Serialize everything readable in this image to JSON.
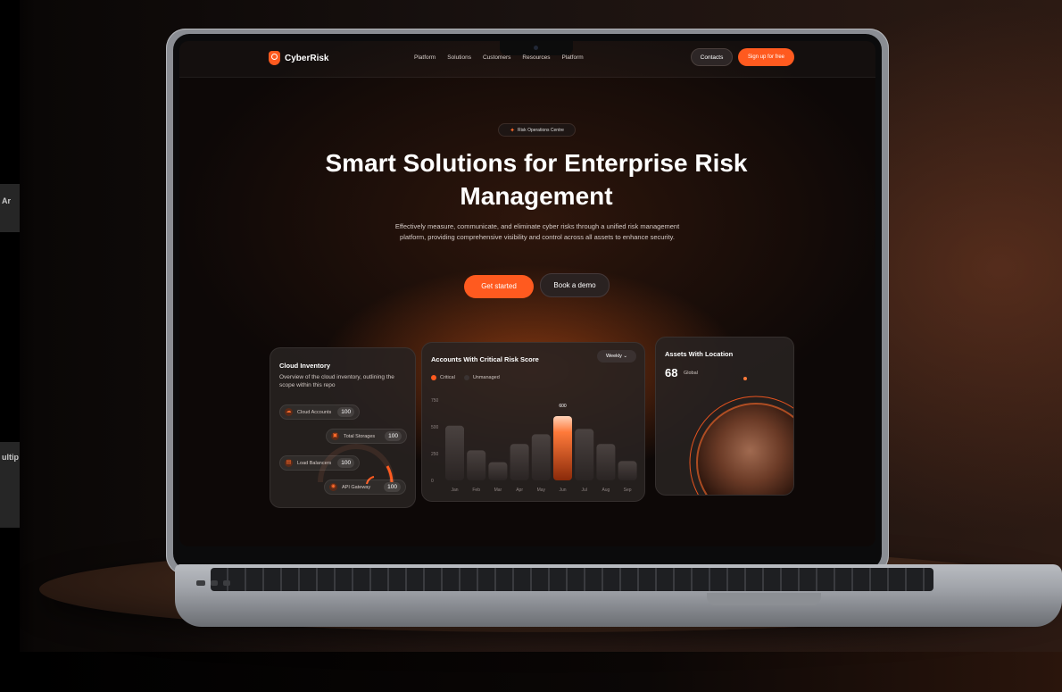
{
  "site": {
    "brand": "CyberRisk",
    "nav": [
      "Platform",
      "Solutions",
      "Customers",
      "Resources",
      "Platform"
    ],
    "contacts_label": "Contacts",
    "signup_label": "Sign up for free"
  },
  "hero": {
    "badge": "Risk Operations Centre",
    "title": "Smart Solutions for Enterprise Risk Management",
    "subtitle": "Effectively measure, communicate, and eliminate cyber risks through a unified risk management platform, providing comprehensive visibility and control across all assets to enhance security.",
    "primary_cta": "Get started",
    "secondary_cta": "Book a demo"
  },
  "cloud_inventory": {
    "title": "Cloud Inventory",
    "description": "Overview of the cloud inventory, outlining the scope within this repo",
    "items": [
      {
        "label": "Cloud Accounts",
        "value": "100"
      },
      {
        "label": "Total Storages",
        "value": "100"
      },
      {
        "label": "Load Balancers",
        "value": "100"
      },
      {
        "label": "API Gateway",
        "value": "100"
      }
    ]
  },
  "accounts_chart": {
    "title": "Accounts With Critical Risk Score",
    "period": "Weekly",
    "legend": [
      "Critical",
      "Unmanaged"
    ],
    "colors": {
      "critical": "#ff5a1f",
      "unmanaged": "#3a3332"
    }
  },
  "chart_data": {
    "type": "bar",
    "title": "Accounts With Critical Risk Score",
    "categories": [
      "Jan",
      "Feb",
      "Mar",
      "Apr",
      "May",
      "Jun",
      "Jul",
      "Aug",
      "Sep"
    ],
    "values": [
      510,
      280,
      170,
      340,
      430,
      600,
      480,
      340,
      180
    ],
    "highlight_index": 5,
    "highlight_label": "600",
    "yticks": [
      "750",
      "500",
      "250",
      "0"
    ],
    "ylim": [
      0,
      750
    ]
  },
  "assets_location": {
    "title": "Assets With Location",
    "count": "68",
    "count_label": "Global"
  },
  "sidebar_peek": [
    "Ar",
    "ultip"
  ]
}
